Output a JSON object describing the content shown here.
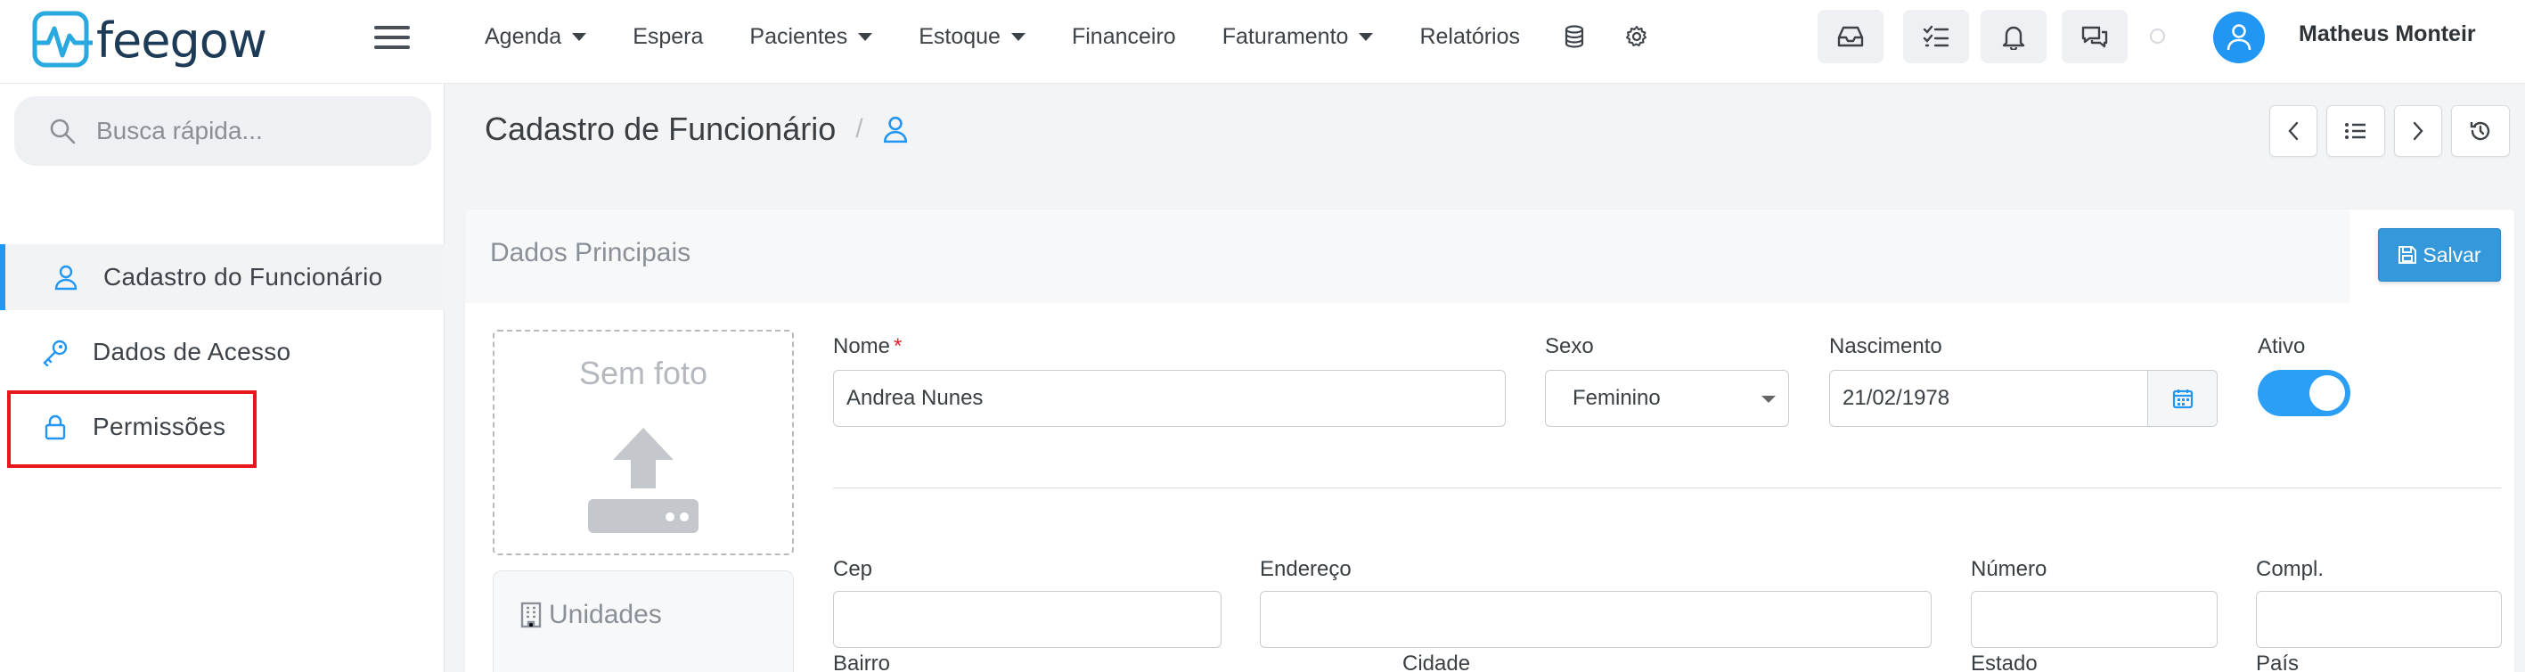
{
  "app": {
    "brand": "feegow"
  },
  "nav": {
    "items": [
      {
        "label": "Agenda",
        "dropdown": true
      },
      {
        "label": "Espera",
        "dropdown": false
      },
      {
        "label": "Pacientes",
        "dropdown": true
      },
      {
        "label": "Estoque",
        "dropdown": true
      },
      {
        "label": "Financeiro",
        "dropdown": false
      },
      {
        "label": "Faturamento",
        "dropdown": true
      },
      {
        "label": "Relatórios",
        "dropdown": false
      }
    ],
    "icons": [
      "database-icon",
      "gear-icon"
    ]
  },
  "toolbar": {
    "buttons": [
      "inbox-icon",
      "checklist-icon",
      "bell-icon",
      "chat-icon"
    ],
    "user_name": "Matheus Monteir"
  },
  "sidebar": {
    "search_placeholder": "Busca rápida...",
    "items": [
      {
        "label": "Cadastro do Funcionário",
        "icon": "user-icon",
        "active": true
      },
      {
        "label": "Dados de Acesso",
        "icon": "key-icon",
        "active": false
      },
      {
        "label": "Permissões",
        "icon": "lock-icon",
        "active": false
      }
    ]
  },
  "page": {
    "title": "Cadastro de Funcionário",
    "separator": "/",
    "header_buttons": [
      "chevron-left-icon",
      "list-icon",
      "chevron-right-icon",
      "history-icon"
    ]
  },
  "panel": {
    "title": "Dados Principais",
    "save_label": "Salvar",
    "photo_label": "Sem foto",
    "unidades_label": "Unidades"
  },
  "form": {
    "nome": {
      "label": "Nome",
      "required_mark": "*",
      "value": "Andrea Nunes"
    },
    "sexo": {
      "label": "Sexo",
      "value": "Feminino"
    },
    "nascimento": {
      "label": "Nascimento",
      "value": "21/02/1978"
    },
    "ativo": {
      "label": "Ativo",
      "checked": true
    },
    "cep": {
      "label": "Cep",
      "value": ""
    },
    "endereco": {
      "label": "Endereço",
      "value": ""
    },
    "numero": {
      "label": "Número",
      "value": ""
    },
    "compl": {
      "label": "Compl.",
      "value": ""
    },
    "bairro": {
      "label": "Bairro"
    },
    "cidade": {
      "label": "Cidade"
    },
    "estado": {
      "label": "Estado"
    },
    "pais": {
      "label": "País"
    }
  },
  "colors": {
    "accent": "#2196f3",
    "highlight": "#e8151b",
    "save": "#3498db"
  }
}
